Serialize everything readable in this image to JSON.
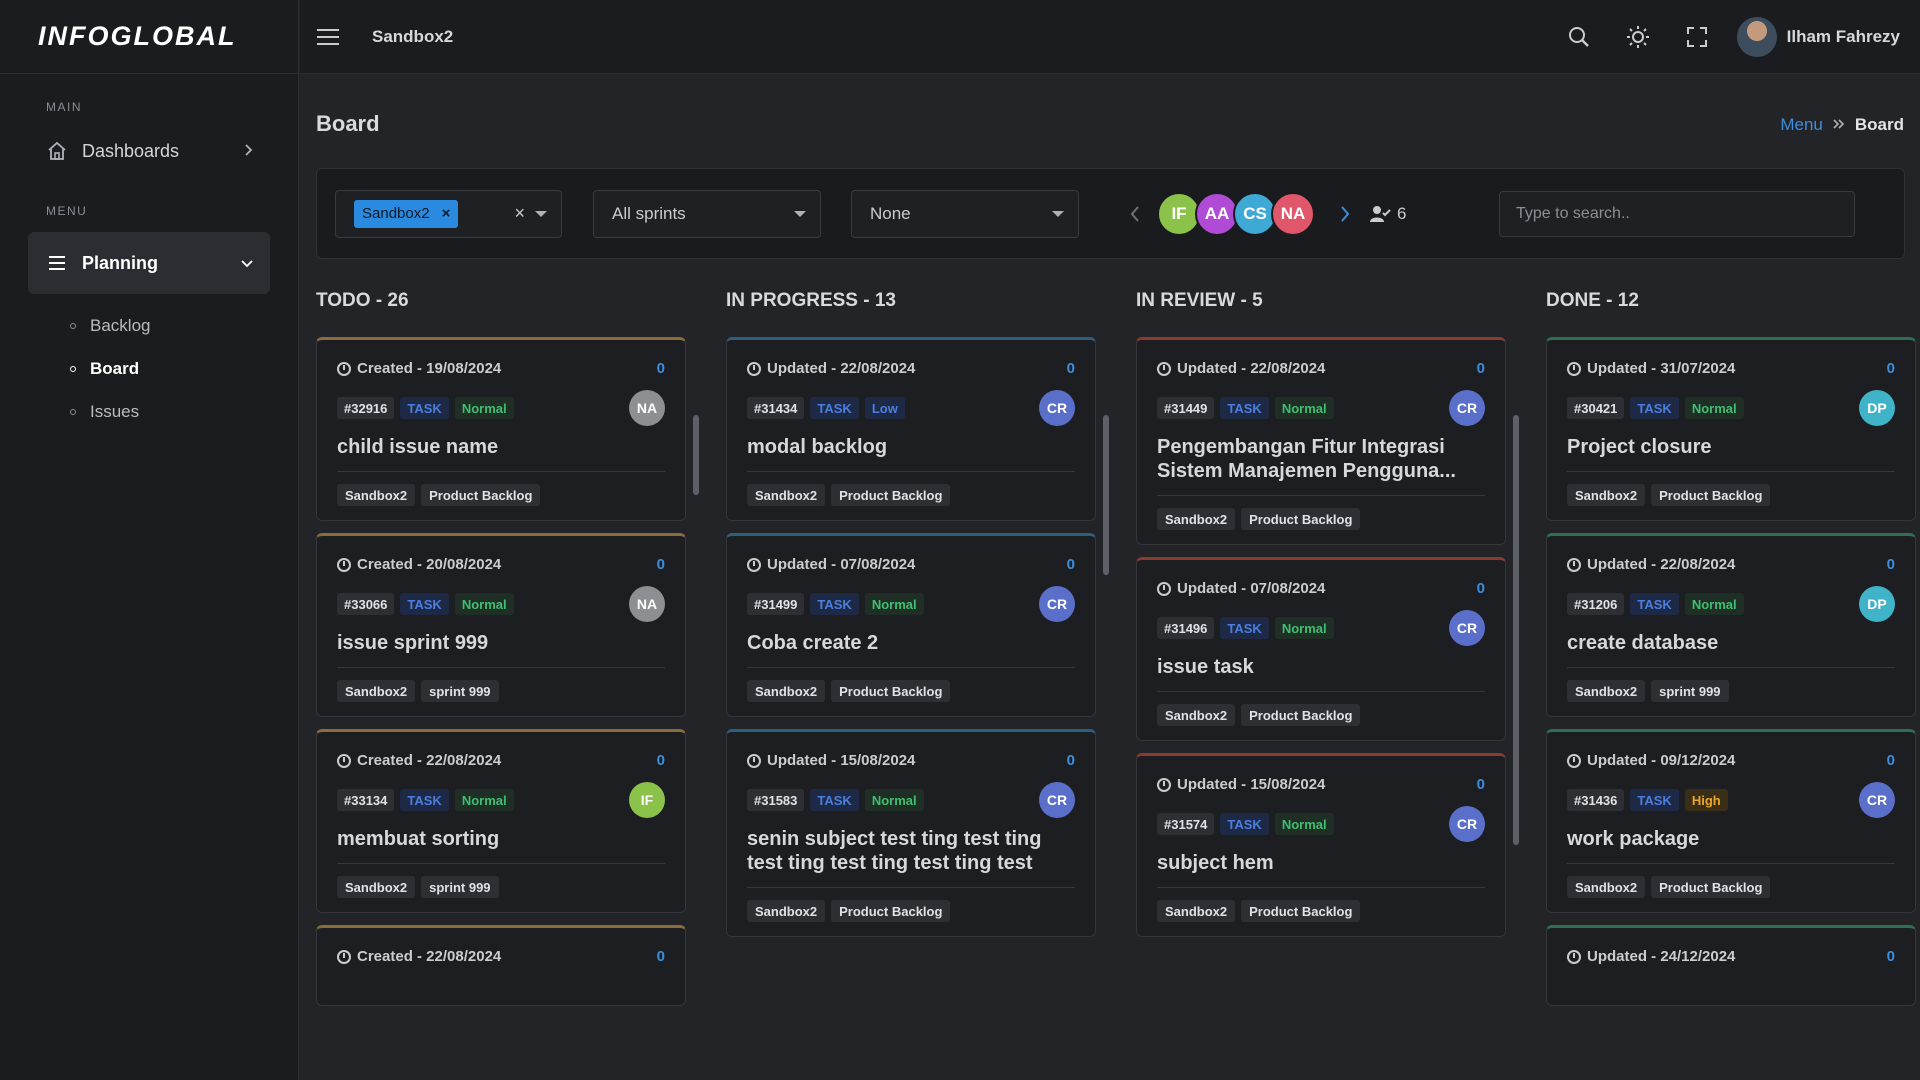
{
  "sidebar": {
    "logo": "INFOGLOBAL",
    "section_main": "MAIN",
    "dashboards": "Dashboards",
    "section_menu": "MENU",
    "planning": "Planning",
    "sub": [
      "Backlog",
      "Board",
      "Issues"
    ]
  },
  "topbar": {
    "project": "Sandbox2",
    "user": "Ilham Fahrezy"
  },
  "page": {
    "title": "Board",
    "breadcrumb": {
      "parent": "Menu",
      "current": "Board"
    }
  },
  "filters": {
    "project_chip": "Sandbox2",
    "sprint": "All sprints",
    "group": "None",
    "avatars": [
      {
        "initials": "IF",
        "color": "#8bc34a"
      },
      {
        "initials": "AA",
        "color": "#b04bd6"
      },
      {
        "initials": "CS",
        "color": "#3fa9d6"
      },
      {
        "initials": "NA",
        "color": "#e0566a"
      }
    ],
    "member_count": "6",
    "search_placeholder": "Type to search.."
  },
  "columns": [
    {
      "title": "TODO - 26",
      "color": "#8a6d3b",
      "cards": [
        {
          "date": "Created - 19/08/2024",
          "count": "0",
          "id": "#32916",
          "type": "TASK",
          "priority": "Normal",
          "avatar": "NA",
          "avatar_color": "#8d8f93",
          "title": "child issue name",
          "labels": [
            "Sandbox2",
            "Product Backlog"
          ]
        },
        {
          "date": "Created - 20/08/2024",
          "count": "0",
          "id": "#33066",
          "type": "TASK",
          "priority": "Normal",
          "avatar": "NA",
          "avatar_color": "#8d8f93",
          "title": "issue sprint 999",
          "labels": [
            "Sandbox2",
            "sprint 999"
          ]
        },
        {
          "date": "Created - 22/08/2024",
          "count": "0",
          "id": "#33134",
          "type": "TASK",
          "priority": "Normal",
          "avatar": "IF",
          "avatar_color": "#8bc34a",
          "title": "membuat sorting",
          "labels": [
            "Sandbox2",
            "sprint 999"
          ]
        },
        {
          "date": "Created - 22/08/2024",
          "count": "0",
          "id": "",
          "type": "",
          "priority": "",
          "avatar": "",
          "avatar_color": "",
          "title": "",
          "labels": []
        }
      ]
    },
    {
      "title": "IN PROGRESS - 13",
      "color": "#2f5f7d",
      "cards": [
        {
          "date": "Updated - 22/08/2024",
          "count": "0",
          "id": "#31434",
          "type": "TASK",
          "priority": "Low",
          "avatar": "CR",
          "avatar_color": "#5a6fc9",
          "title": "modal backlog",
          "labels": [
            "Sandbox2",
            "Product Backlog"
          ]
        },
        {
          "date": "Updated - 07/08/2024",
          "count": "0",
          "id": "#31499",
          "type": "TASK",
          "priority": "Normal",
          "avatar": "CR",
          "avatar_color": "#5a6fc9",
          "title": "Coba create 2",
          "labels": [
            "Sandbox2",
            "Product Backlog"
          ]
        },
        {
          "date": "Updated - 15/08/2024",
          "count": "0",
          "id": "#31583",
          "type": "TASK",
          "priority": "Normal",
          "avatar": "CR",
          "avatar_color": "#5a6fc9",
          "title": "senin subject test ting test ting test ting test ting test ting test",
          "labels": [
            "Sandbox2",
            "Product Backlog"
          ]
        }
      ]
    },
    {
      "title": "IN REVIEW - 5",
      "color": "#8a3a2e",
      "cards": [
        {
          "date": "Updated - 22/08/2024",
          "count": "0",
          "id": "#31449",
          "type": "TASK",
          "priority": "Normal",
          "avatar": "CR",
          "avatar_color": "#5a6fc9",
          "title": "Pengembangan Fitur Integrasi Sistem Manajemen Pengguna...",
          "labels": [
            "Sandbox2",
            "Product Backlog"
          ]
        },
        {
          "date": "Updated - 07/08/2024",
          "count": "0",
          "id": "#31496",
          "type": "TASK",
          "priority": "Normal",
          "avatar": "CR",
          "avatar_color": "#5a6fc9",
          "title": "issue task",
          "labels": [
            "Sandbox2",
            "Product Backlog"
          ]
        },
        {
          "date": "Updated - 15/08/2024",
          "count": "0",
          "id": "#31574",
          "type": "TASK",
          "priority": "Normal",
          "avatar": "CR",
          "avatar_color": "#5a6fc9",
          "title": "subject hem",
          "labels": [
            "Sandbox2",
            "Product Backlog"
          ]
        }
      ]
    },
    {
      "title": "DONE - 12",
      "color": "#2e6e55",
      "cards": [
        {
          "date": "Updated - 31/07/2024",
          "count": "0",
          "id": "#30421",
          "type": "TASK",
          "priority": "Normal",
          "avatar": "DP",
          "avatar_color": "#3fb3c8",
          "title": "Project closure",
          "labels": [
            "Sandbox2",
            "Product Backlog"
          ]
        },
        {
          "date": "Updated - 22/08/2024",
          "count": "0",
          "id": "#31206",
          "type": "TASK",
          "priority": "Normal",
          "avatar": "DP",
          "avatar_color": "#3fb3c8",
          "title": "create database",
          "labels": [
            "Sandbox2",
            "sprint 999"
          ]
        },
        {
          "date": "Updated - 09/12/2024",
          "count": "0",
          "id": "#31436",
          "type": "TASK",
          "priority": "High",
          "avatar": "CR",
          "avatar_color": "#5a6fc9",
          "title": "work package",
          "labels": [
            "Sandbox2",
            "Product Backlog"
          ]
        },
        {
          "date": "Updated - 24/12/2024",
          "count": "0",
          "id": "",
          "type": "",
          "priority": "",
          "avatar": "",
          "avatar_color": "",
          "title": "",
          "labels": []
        }
      ]
    }
  ]
}
